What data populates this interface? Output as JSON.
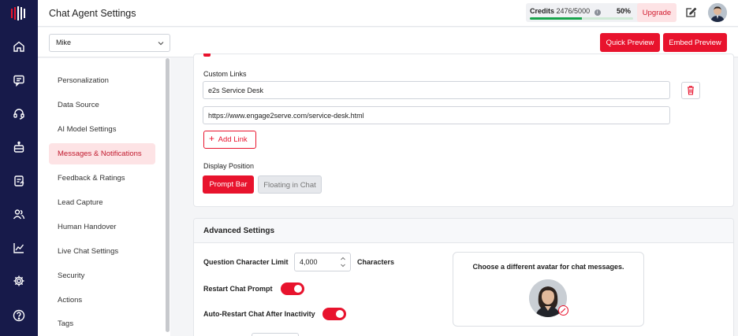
{
  "header": {
    "title": "Chat Agent Settings"
  },
  "credits": {
    "label": "Credits",
    "value": "2476/5000",
    "percent_text": "50%",
    "percent": 50,
    "upgrade_label": "Upgrade"
  },
  "toolbar": {
    "agent": "Mike",
    "quick_preview": "Quick Preview",
    "embed_preview": "Embed Preview"
  },
  "nav": {
    "items": [
      {
        "label": "Personalization"
      },
      {
        "label": "Data Source"
      },
      {
        "label": "AI Model Settings"
      },
      {
        "label": "Messages & Notifications",
        "active": true
      },
      {
        "label": "Feedback & Ratings"
      },
      {
        "label": "Lead Capture"
      },
      {
        "label": "Human Handover"
      },
      {
        "label": "Live Chat Settings"
      },
      {
        "label": "Security"
      },
      {
        "label": "Actions"
      },
      {
        "label": "Tags"
      }
    ]
  },
  "links": {
    "heading": "Custom Links",
    "name": "e2s Service Desk",
    "url": "https://www.engage2serve.com/service-desk.html",
    "add_label": "Add Link",
    "position_heading": "Display Position",
    "position_options": [
      "Prompt Bar",
      "Floating in Chat"
    ],
    "selected_position": "Prompt Bar"
  },
  "advanced": {
    "title": "Advanced Settings",
    "char_limit_label": "Question Character Limit",
    "char_limit_value": "4,000",
    "char_limit_unit": "Characters",
    "restart_label": "Restart Chat Prompt",
    "restart_on": true,
    "auto_restart_label": "Auto-Restart Chat After Inactivity",
    "auto_restart_on": true,
    "avatar_prompt": "Choose a different avatar for chat messages."
  },
  "colors": {
    "accent": "#e8132d",
    "rail": "#171a4a",
    "progress": "#18a44b"
  }
}
